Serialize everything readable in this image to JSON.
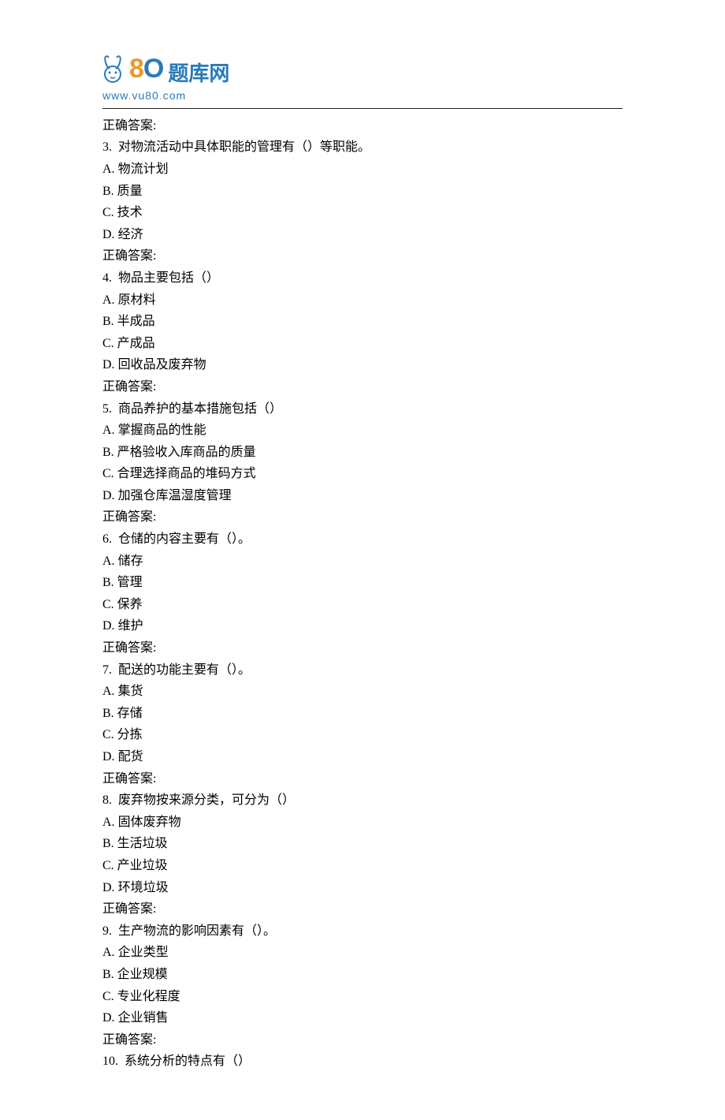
{
  "logo": {
    "num8": "8",
    "num0": "O",
    "brand_text": "题库网",
    "url_prefix": "www",
    "url_mid": "vu80",
    "url_suffix": "com"
  },
  "answer_label": "正确答案:",
  "questions": [
    {
      "number": "3.",
      "text": "对物流活动中具体职能的管理有（）等职能。",
      "choices": [
        {
          "label": "A.",
          "text": "物流计划"
        },
        {
          "label": "B.",
          "text": "质量"
        },
        {
          "label": "C.",
          "text": "技术"
        },
        {
          "label": "D.",
          "text": "经济"
        }
      ]
    },
    {
      "number": "4.",
      "text": "物品主要包括（）",
      "choices": [
        {
          "label": "A.",
          "text": "原材料"
        },
        {
          "label": "B.",
          "text": "半成品"
        },
        {
          "label": "C.",
          "text": "产成品"
        },
        {
          "label": "D.",
          "text": "回收品及废弃物"
        }
      ]
    },
    {
      "number": "5.",
      "text": "商品养护的基本措施包括（）",
      "choices": [
        {
          "label": "A.",
          "text": "掌握商品的性能"
        },
        {
          "label": "B.",
          "text": "严格验收入库商品的质量"
        },
        {
          "label": "C.",
          "text": "合理选择商品的堆码方式"
        },
        {
          "label": "D.",
          "text": "加强仓库温湿度管理"
        }
      ]
    },
    {
      "number": "6.",
      "text": "仓储的内容主要有（）。",
      "choices": [
        {
          "label": "A.",
          "text": "储存"
        },
        {
          "label": "B.",
          "text": "管理"
        },
        {
          "label": "C.",
          "text": "保养"
        },
        {
          "label": "D.",
          "text": "维护"
        }
      ]
    },
    {
      "number": "7.",
      "text": "配送的功能主要有（）。",
      "choices": [
        {
          "label": "A.",
          "text": "集货"
        },
        {
          "label": "B.",
          "text": "存储"
        },
        {
          "label": "C.",
          "text": "分拣"
        },
        {
          "label": "D.",
          "text": "配货"
        }
      ]
    },
    {
      "number": "8.",
      "text": "废弃物按来源分类，可分为（）",
      "choices": [
        {
          "label": "A.",
          "text": "固体废弃物"
        },
        {
          "label": "B.",
          "text": "生活垃圾"
        },
        {
          "label": "C.",
          "text": "产业垃圾"
        },
        {
          "label": "D.",
          "text": "环境垃圾"
        }
      ]
    },
    {
      "number": "9.",
      "text": "生产物流的影响因素有（）。",
      "choices": [
        {
          "label": "A.",
          "text": "企业类型"
        },
        {
          "label": "B.",
          "text": "企业规模"
        },
        {
          "label": "C.",
          "text": "专业化程度"
        },
        {
          "label": "D.",
          "text": "企业销售"
        }
      ]
    },
    {
      "number": "10.",
      "text": "系统分析的特点有（）",
      "choices": []
    }
  ]
}
